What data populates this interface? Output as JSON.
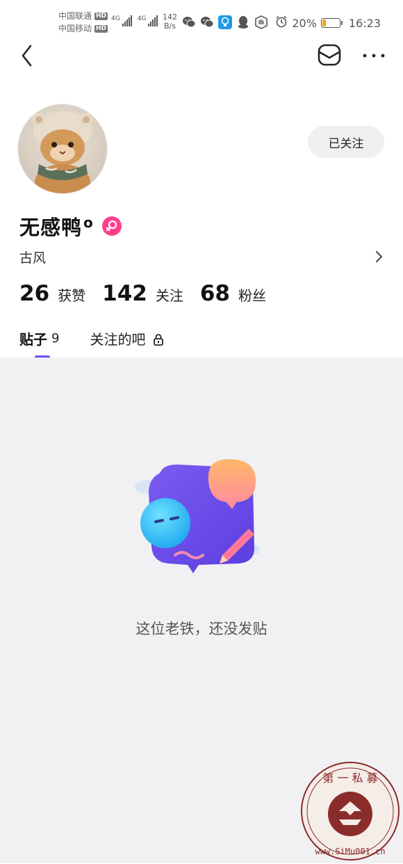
{
  "status_bar": {
    "carrier_1": "中国联通",
    "carrier_2": "中国移动",
    "hd_label": "HD",
    "net_1": "4G",
    "net_2": "4G",
    "speed_value": "142",
    "speed_unit": "B/s",
    "battery_percent": "20%",
    "battery_level": 0.2,
    "time": "16:23",
    "icons": [
      "wechat-icon",
      "wechat-icon",
      "bulb-app-icon",
      "qq-icon",
      "hand-app-icon",
      "alarm-icon"
    ]
  },
  "nav": {
    "icons": [
      "back-icon",
      "mail-icon",
      "more-icon"
    ]
  },
  "profile": {
    "follow_button": "已关注",
    "username": "无感鸭",
    "username_suffix": "o",
    "gender_badge_icon": "female-icon",
    "bio": "古风",
    "stats": [
      {
        "num": "26",
        "label": "获赞"
      },
      {
        "num": "142",
        "label": "关注"
      },
      {
        "num": "68",
        "label": "粉丝"
      }
    ]
  },
  "tabs": [
    {
      "label": "贴子",
      "count": "9",
      "active": true
    },
    {
      "label": "关注的吧",
      "count": "",
      "active": false,
      "icon": "lock-icon"
    }
  ],
  "empty_state": {
    "text": "这位老铁，还没发贴"
  },
  "watermark": {
    "top_chars": "第 一 私 募",
    "url": "www.SiMu001.cn"
  },
  "colors": {
    "accent": "#6f4cff",
    "female_badge": "#ff3f8c",
    "content_bg": "#f1f1f4",
    "watermark_red": "#8b2c2c"
  }
}
